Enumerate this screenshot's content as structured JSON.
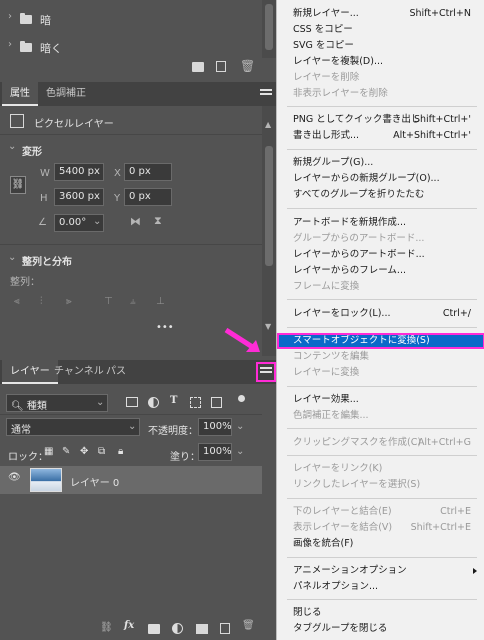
{
  "layers_top": {
    "items": [
      {
        "label": "暗"
      },
      {
        "label": "暗く"
      }
    ]
  },
  "properties": {
    "tabs": [
      "属性",
      "色調補正"
    ],
    "type_label": "ピクセルレイヤー",
    "transform_title": "変形",
    "w_label": "W",
    "w_value": "5400 px",
    "h_label": "H",
    "h_value": "3600 px",
    "x_label": "X",
    "x_value": "0 px",
    "y_label": "Y",
    "y_value": "0 px",
    "angle_value": "0.00°",
    "align_title": "整列と分布",
    "align_sub": "整列：",
    "more": "•••"
  },
  "layers_panel": {
    "tabs": [
      "レイヤー",
      "チャンネル",
      "パス"
    ],
    "filter_kind": "種類",
    "blend_mode": "通常",
    "opacity_label": "不透明度：",
    "opacity_value": "100%",
    "lock_label": "ロック：",
    "fill_label": "塗り：",
    "fill_value": "100%",
    "layer_name": "レイヤー 0"
  },
  "menu": {
    "items": [
      {
        "label": "新規レイヤー...",
        "shortcut": "Shift+Ctrl+N",
        "disabled": false
      },
      {
        "label": "CSS をコピー",
        "shortcut": "",
        "disabled": false
      },
      {
        "label": "SVG をコピー",
        "shortcut": "",
        "disabled": false
      },
      {
        "label": "レイヤーを複製(D)...",
        "shortcut": "",
        "disabled": false
      },
      {
        "label": "レイヤーを削除",
        "shortcut": "",
        "disabled": true
      },
      {
        "label": "非表示レイヤーを削除",
        "shortcut": "",
        "disabled": true
      },
      {
        "label": "PNG としてクイック書き出し",
        "shortcut": "Shift+Ctrl+'",
        "disabled": false
      },
      {
        "label": "書き出し形式...",
        "shortcut": "Alt+Shift+Ctrl+'",
        "disabled": false
      },
      {
        "label": "新規グループ(G)...",
        "shortcut": "",
        "disabled": false
      },
      {
        "label": "レイヤーからの新規グループ(O)...",
        "shortcut": "",
        "disabled": false
      },
      {
        "label": "すべてのグループを折りたたむ",
        "shortcut": "",
        "disabled": false
      },
      {
        "label": "アートボードを新規作成...",
        "shortcut": "",
        "disabled": false
      },
      {
        "label": "グループからのアートボード...",
        "shortcut": "",
        "disabled": true
      },
      {
        "label": "レイヤーからのアートボード...",
        "shortcut": "",
        "disabled": false
      },
      {
        "label": "レイヤーからのフレーム...",
        "shortcut": "",
        "disabled": false
      },
      {
        "label": "フレームに変換",
        "shortcut": "",
        "disabled": true
      },
      {
        "label": "レイヤーをロック(L)...",
        "shortcut": "Ctrl+/",
        "disabled": false
      },
      {
        "label": "スマートオブジェクトに変換(S)",
        "shortcut": "",
        "disabled": false,
        "highlighted": true
      },
      {
        "label": "コンテンツを編集",
        "shortcut": "",
        "disabled": true
      },
      {
        "label": "レイヤーに変換",
        "shortcut": "",
        "disabled": true
      },
      {
        "label": "レイヤー効果...",
        "shortcut": "",
        "disabled": false
      },
      {
        "label": "色調補正を編集...",
        "shortcut": "",
        "disabled": true
      },
      {
        "label": "クリッピングマスクを作成(C)",
        "shortcut": "Alt+Ctrl+G",
        "disabled": true
      },
      {
        "label": "レイヤーをリンク(K)",
        "shortcut": "",
        "disabled": true
      },
      {
        "label": "リンクしたレイヤーを選択(S)",
        "shortcut": "",
        "disabled": true
      },
      {
        "label": "下のレイヤーと結合(E)",
        "shortcut": "Ctrl+E",
        "disabled": true
      },
      {
        "label": "表示レイヤーを結合(V)",
        "shortcut": "Shift+Ctrl+E",
        "disabled": true
      },
      {
        "label": "画像を統合(F)",
        "shortcut": "",
        "disabled": false
      },
      {
        "label": "アニメーションオプション",
        "shortcut": "",
        "disabled": false,
        "submenu": true
      },
      {
        "label": "パネルオプション...",
        "shortcut": "",
        "disabled": false
      },
      {
        "label": "閉じる",
        "shortcut": "",
        "disabled": false
      },
      {
        "label": "タブグループを閉じる",
        "shortcut": "",
        "disabled": false
      }
    ]
  },
  "colors": {
    "panel_bg": "#535353",
    "menu_bg": "#f1f1f1",
    "highlight": "#0a69c9",
    "annotation": "#ff2bd6"
  }
}
